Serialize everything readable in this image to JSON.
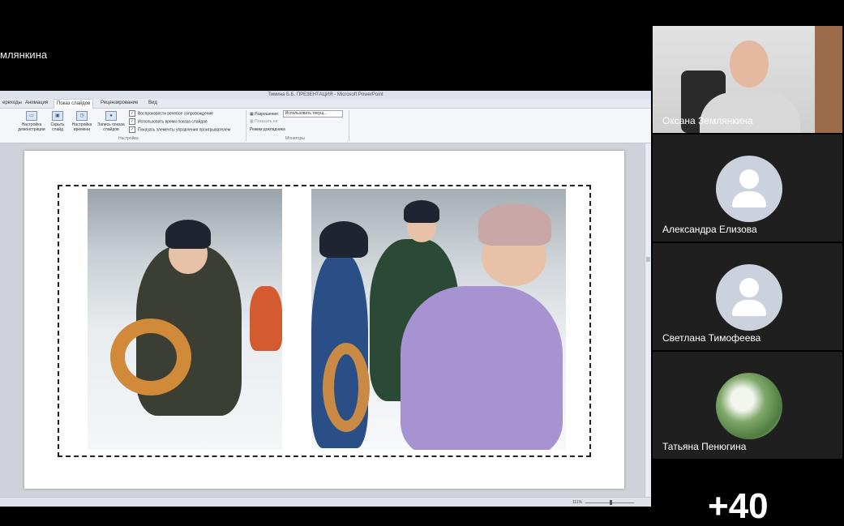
{
  "presenter": {
    "name_partial": "млянкина"
  },
  "ppt": {
    "window_title": "Тимина Б.Б. ПРЕЗЕНТАЦИЯ - Microsoft PowerPoint",
    "tabs": [
      "ереходы",
      "Анимация",
      "Показ слайдов",
      "Рецензирование",
      "Вид"
    ],
    "ribbon": {
      "btn_setup": "Настройка демонстрации",
      "btn_hide": "Скрыть слайд",
      "btn_rehearse": "Настройка времени",
      "btn_record": "Запись показа слайдов",
      "chk_narration": "Воспроизвести речевое сопровождение",
      "chk_timings": "Использовать время показа слайдов",
      "chk_controls": "Показать элементы управления проигрывателем",
      "group_setup": "Настройка",
      "resolution_label": "Разрешение:",
      "resolution_value": "Использовать текущ...",
      "show_on_label": "Показать на:",
      "presenter_view": "Режим докладчика",
      "group_monitors": "Мониторы"
    },
    "status": {
      "zoom": "111%"
    }
  },
  "participants": [
    {
      "name": "Оксана Землянкина"
    },
    {
      "name": "Александра Елизова"
    },
    {
      "name": "Светлана Тимофеева"
    },
    {
      "name": "Татьяна Пенюгина"
    }
  ],
  "more_count": "+40",
  "colors": {
    "avatar_bg": "#ccd1de",
    "tile_bg": "#1f1f1f",
    "accent": "#2d6fc7"
  }
}
